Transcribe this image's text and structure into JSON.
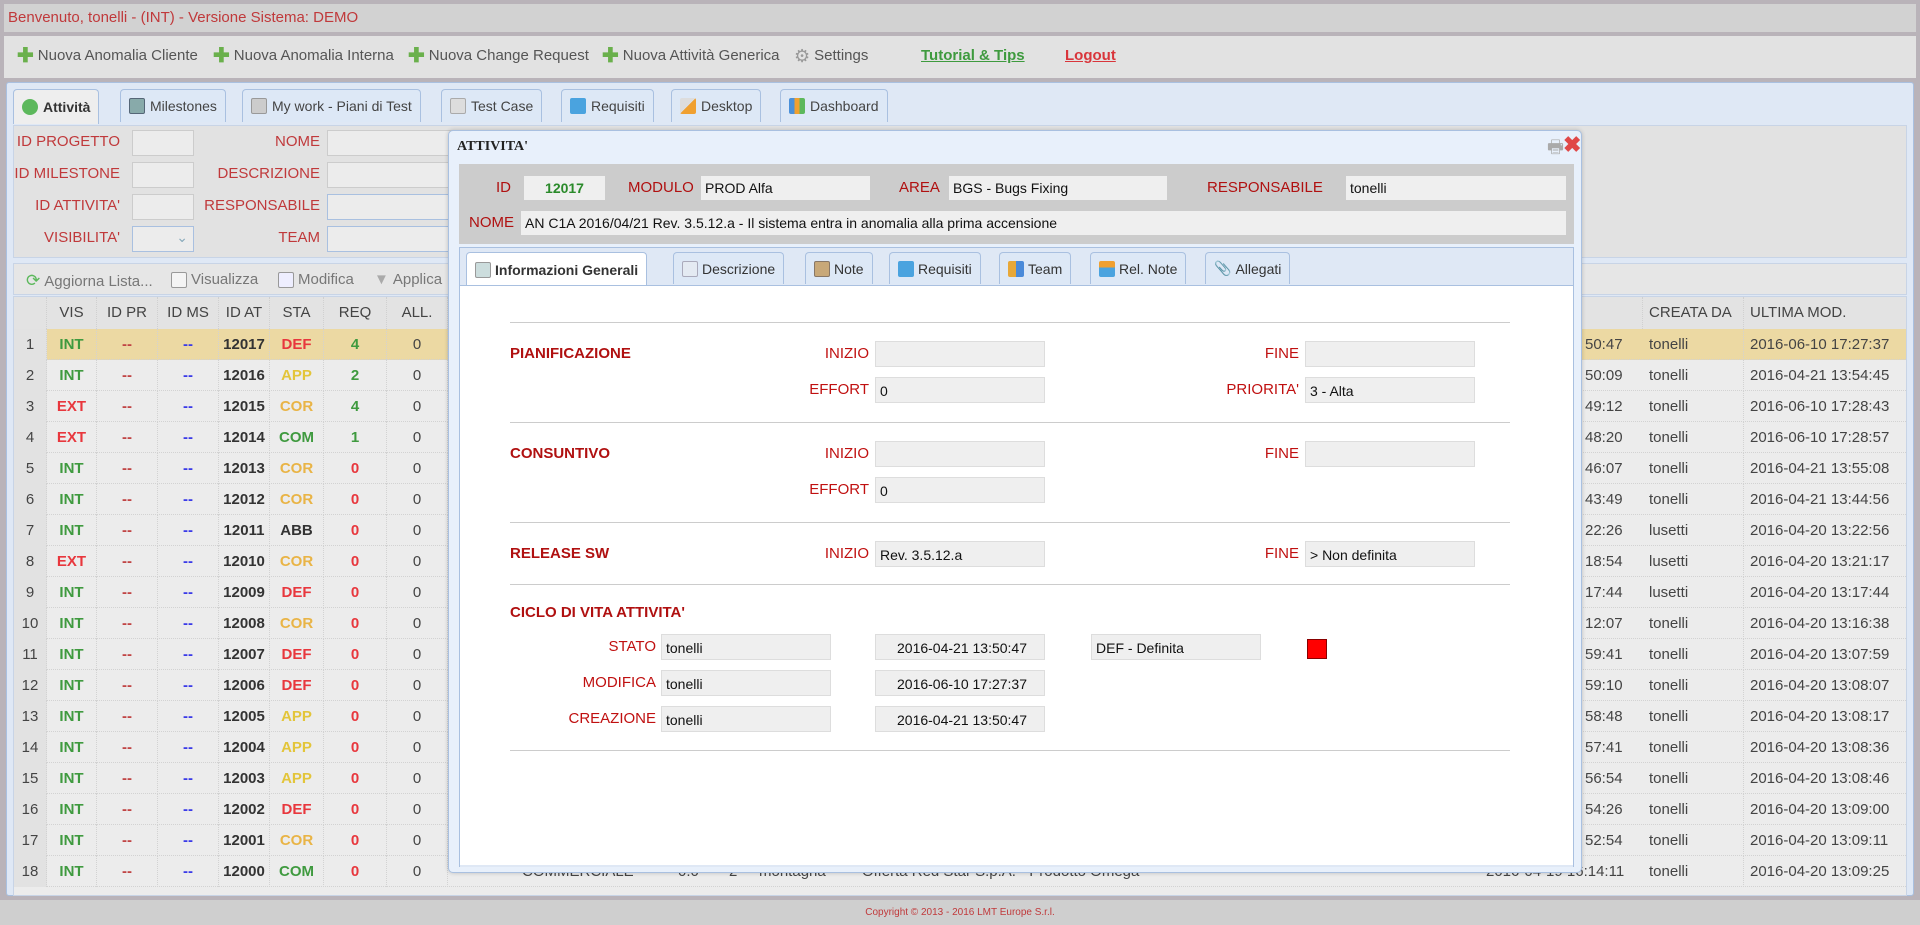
{
  "title": "Benvenuto, tonelli - (INT) - Versione Sistema: DEMO",
  "toolbar": {
    "items": [
      {
        "label": "Nuova Anomalia Cliente",
        "icon": "plus-icon"
      },
      {
        "label": "Nuova Anomalia Interna",
        "icon": "plus-icon"
      },
      {
        "label": "Nuova Change Request",
        "icon": "plus-icon"
      },
      {
        "label": "Nuova Attività Generica",
        "icon": "plus-icon"
      },
      {
        "label": "Settings",
        "icon": "gear-icon"
      }
    ],
    "tutorial": "Tutorial & Tips",
    "logout": "Logout"
  },
  "tabs": [
    "Attività",
    "Milestones",
    "My work - Piani di Test",
    "Test Case",
    "Requisiti",
    "Desktop",
    "Dashboard"
  ],
  "filter": {
    "id_progetto": "ID PROGETTO",
    "id_milestone": "ID MILESTONE",
    "id_attivita": "ID ATTIVITA'",
    "visibilita": "VISIBILITA'",
    "nome": "NOME",
    "descrizione": "DESCRIZIONE",
    "responsabile": "RESPONSABILE",
    "team": "TEAM"
  },
  "grid_toolbar": {
    "refresh": "Aggiorna Lista...",
    "view": "Visualizza",
    "edit": "Modifica",
    "apply": "Applica"
  },
  "grid": {
    "headers": [
      "VIS",
      "ID PR",
      "ID MS",
      "ID AT",
      "STA",
      "REQ",
      "ALL.",
      "CREATA DA",
      "ULTIMA MOD."
    ],
    "rows": [
      {
        "n": "1",
        "vis": "INT",
        "pr": "--",
        "ms": "--",
        "at": "12017",
        "sta": "DEF",
        "req": "4",
        "all": "0",
        "created": "50:47",
        "by": "tonelli",
        "mod": "2016-06-10 17:27:37"
      },
      {
        "n": "2",
        "vis": "INT",
        "pr": "--",
        "ms": "--",
        "at": "12016",
        "sta": "APP",
        "req": "2",
        "all": "0",
        "created": "50:09",
        "by": "tonelli",
        "mod": "2016-04-21 13:54:45"
      },
      {
        "n": "3",
        "vis": "EXT",
        "pr": "--",
        "ms": "--",
        "at": "12015",
        "sta": "COR",
        "req": "4",
        "all": "0",
        "created": "49:12",
        "by": "tonelli",
        "mod": "2016-06-10 17:28:43"
      },
      {
        "n": "4",
        "vis": "EXT",
        "pr": "--",
        "ms": "--",
        "at": "12014",
        "sta": "COM",
        "req": "1",
        "all": "0",
        "created": "48:20",
        "by": "tonelli",
        "mod": "2016-06-10 17:28:57"
      },
      {
        "n": "5",
        "vis": "INT",
        "pr": "--",
        "ms": "--",
        "at": "12013",
        "sta": "COR",
        "req": "0",
        "all": "0",
        "created": "46:07",
        "by": "tonelli",
        "mod": "2016-04-21 13:55:08"
      },
      {
        "n": "6",
        "vis": "INT",
        "pr": "--",
        "ms": "--",
        "at": "12012",
        "sta": "COR",
        "req": "0",
        "all": "0",
        "created": "43:49",
        "by": "tonelli",
        "mod": "2016-04-21 13:44:56"
      },
      {
        "n": "7",
        "vis": "INT",
        "pr": "--",
        "ms": "--",
        "at": "12011",
        "sta": "ABB",
        "req": "0",
        "all": "0",
        "created": "22:26",
        "by": "lusetti",
        "mod": "2016-04-20 13:22:56"
      },
      {
        "n": "8",
        "vis": "EXT",
        "pr": "--",
        "ms": "--",
        "at": "12010",
        "sta": "COR",
        "req": "0",
        "all": "0",
        "created": "18:54",
        "by": "lusetti",
        "mod": "2016-04-20 13:21:17"
      },
      {
        "n": "9",
        "vis": "INT",
        "pr": "--",
        "ms": "--",
        "at": "12009",
        "sta": "DEF",
        "req": "0",
        "all": "0",
        "created": "17:44",
        "by": "lusetti",
        "mod": "2016-04-20 13:17:44"
      },
      {
        "n": "10",
        "vis": "INT",
        "pr": "--",
        "ms": "--",
        "at": "12008",
        "sta": "COR",
        "req": "0",
        "all": "0",
        "created": "12:07",
        "by": "tonelli",
        "mod": "2016-04-20 13:16:38"
      },
      {
        "n": "11",
        "vis": "INT",
        "pr": "--",
        "ms": "--",
        "at": "12007",
        "sta": "DEF",
        "req": "0",
        "all": "0",
        "created": "59:41",
        "by": "tonelli",
        "mod": "2016-04-20 13:07:59"
      },
      {
        "n": "12",
        "vis": "INT",
        "pr": "--",
        "ms": "--",
        "at": "12006",
        "sta": "DEF",
        "req": "0",
        "all": "0",
        "created": "59:10",
        "by": "tonelli",
        "mod": "2016-04-20 13:08:07"
      },
      {
        "n": "13",
        "vis": "INT",
        "pr": "--",
        "ms": "--",
        "at": "12005",
        "sta": "APP",
        "req": "0",
        "all": "0",
        "created": "58:48",
        "by": "tonelli",
        "mod": "2016-04-20 13:08:17"
      },
      {
        "n": "14",
        "vis": "INT",
        "pr": "--",
        "ms": "--",
        "at": "12004",
        "sta": "APP",
        "req": "0",
        "all": "0",
        "created": "57:41",
        "by": "tonelli",
        "mod": "2016-04-20 13:08:36"
      },
      {
        "n": "15",
        "vis": "INT",
        "pr": "--",
        "ms": "--",
        "at": "12003",
        "sta": "APP",
        "req": "0",
        "all": "0",
        "created": "56:54",
        "by": "tonelli",
        "mod": "2016-04-20 13:08:46"
      },
      {
        "n": "16",
        "vis": "INT",
        "pr": "--",
        "ms": "--",
        "at": "12002",
        "sta": "DEF",
        "req": "0",
        "all": "0",
        "created": "54:26",
        "by": "tonelli",
        "mod": "2016-04-20 13:09:00"
      },
      {
        "n": "17",
        "vis": "INT",
        "pr": "--",
        "ms": "--",
        "at": "12001",
        "sta": "COR",
        "req": "0",
        "all": "0",
        "created": "52:54",
        "by": "tonelli",
        "mod": "2016-04-20 13:09:11"
      },
      {
        "n": "18",
        "vis": "INT",
        "pr": "--",
        "ms": "--",
        "at": "12000",
        "sta": "COM",
        "req": "0",
        "all": "0",
        "created": "2016-04-19 16:14:11",
        "by": "tonelli",
        "mod": "2016-04-20 13:09:25",
        "extra": [
          "COMMERCIALE",
          "0.0",
          "2",
          "montagna",
          "Offerta Red Star S.p.A. - Prodotto Omega"
        ]
      }
    ]
  },
  "colors": {
    "INT": "#3f9a3f",
    "EXT": "#e8373d",
    "DEF": "#e8373d",
    "APP": "#e3c53a",
    "COR": "#e9b446",
    "COM": "#3f9a3f",
    "ABB": "#333333",
    "req_pos": "#3f9a3f",
    "req_zero": "#e8373d",
    "pr": "#c04444",
    "ms": "#3a3ae8",
    "selected_row": "#ecd9a3"
  },
  "modal": {
    "title": "ATTIVITA'",
    "id_label": "ID",
    "id": "12017",
    "modulo_label": "MODULO",
    "modulo": "PROD Alfa",
    "area_label": "AREA",
    "area": "BGS - Bugs Fixing",
    "resp_label": "RESPONSABILE",
    "resp": "tonelli",
    "nome_label": "NOME",
    "nome": "AN C1A 2016/04/21 Rev. 3.5.12.a - Il sistema entra in anomalia alla prima accensione",
    "tabs": [
      "Informazioni Generali",
      "Descrizione",
      "Note",
      "Requisiti",
      "Team",
      "Rel. Note",
      "Allegati"
    ],
    "pian": {
      "title": "PIANIFICAZIONE",
      "inizio_label": "INIZIO",
      "inizio": "",
      "fine_label": "FINE",
      "fine": "",
      "effort_label": "EFFORT",
      "effort": "0",
      "priorita_label": "PRIORITA'",
      "priorita": "3 - Alta"
    },
    "cons": {
      "title": "CONSUNTIVO",
      "inizio_label": "INIZIO",
      "inizio": "",
      "fine_label": "FINE",
      "fine": "",
      "effort_label": "EFFORT",
      "effort": "0"
    },
    "rel": {
      "title": "RELEASE SW",
      "inizio_label": "INIZIO",
      "inizio": "Rev. 3.5.12.a",
      "fine_label": "FINE",
      "fine": "> Non definita"
    },
    "ciclo": {
      "title": "CICLO DI VITA ATTIVITA'",
      "stato_label": "STATO",
      "stato_user": "tonelli",
      "stato_date": "2016-04-21 13:50:47",
      "stato_value": "DEF - Definita",
      "stato_color": "#ff0000",
      "mod_label": "MODIFICA",
      "mod_user": "tonelli",
      "mod_date": "2016-06-10 17:27:37",
      "crea_label": "CREAZIONE",
      "crea_user": "tonelli",
      "crea_date": "2016-04-21 13:50:47"
    }
  },
  "footer": "Copyright © 2013 - 2016 LMT Europe S.r.l."
}
